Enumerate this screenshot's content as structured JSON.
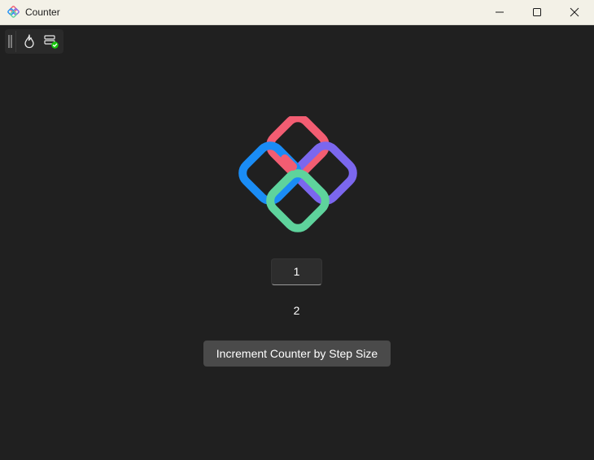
{
  "window": {
    "title": "Counter"
  },
  "devtools": {
    "grip_icon": "grip-icon",
    "hot_reload_icon": "flame-icon",
    "diagnostics_icon": "diagnostics-check-icon"
  },
  "main": {
    "logo_icon": "uno-platform-logo",
    "step_size_value": "1",
    "counter_value": "2",
    "increment_button_label": "Increment Counter by Step Size"
  },
  "colors": {
    "window_background": "#202020",
    "titlebar_background": "#f3f1e7",
    "button_background": "#4a4a4a",
    "logo_red": "#f25d72",
    "logo_purple": "#7b67ee",
    "logo_blue": "#1a8cf5",
    "logo_green": "#5ed39c"
  }
}
